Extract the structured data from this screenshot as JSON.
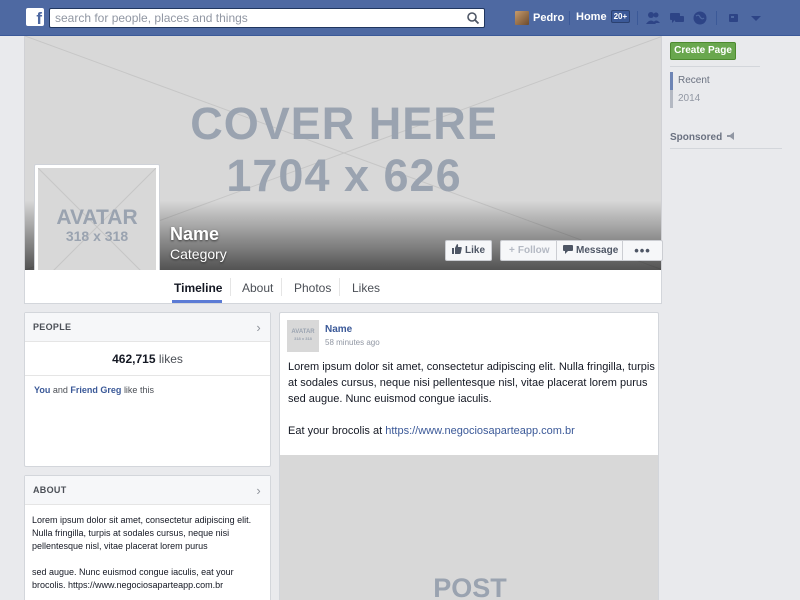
{
  "topbar": {
    "logo": "f",
    "search_placeholder": "search for people, places and things",
    "user_name": "Pedro",
    "home_label": "Home",
    "home_count": "20+"
  },
  "cover": {
    "line1": "COVER HERE",
    "line2": "1704 x 626"
  },
  "avatar": {
    "line1": "AVATAR",
    "line2": "318 x 318"
  },
  "page": {
    "name": "Name",
    "category": "Category"
  },
  "actions": {
    "like": "Like",
    "follow": "Follow",
    "message": "Message",
    "more": "•••"
  },
  "tabs": [
    "Timeline",
    "About",
    "Photos",
    "Likes"
  ],
  "people": {
    "title": "PEOPLE",
    "likes_count": "462,715",
    "likes_word": "likes",
    "friend1": "You",
    "and_word": "and",
    "friend2": "Friend Greg",
    "like_this": "like this"
  },
  "about": {
    "title": "ABOUT",
    "para1": "Lorem ipsum dolor sit amet, consectetur adipiscing elit. Nulla fringilla, turpis at sodales cursus, neque nisi pellentesque nisl, vitae placerat lorem purus",
    "para2": "sed augue. Nunc euismod congue iaculis, eat your brocolis. https://www.negociosaparteapp.com.br"
  },
  "post": {
    "thumb_line1": "AVATAR",
    "thumb_line2": "318 x 318",
    "author": "Name",
    "time": "58 minutes ago",
    "text": "Lorem ipsum dolor sit amet, consectetur adipiscing elit. Nulla fringilla, turpis at sodales cursus, neque nisi pellentesque nisl, vitae placerat lorem purus sed augue. Nunc euismod congue iaculis.",
    "text2": "Eat your brocolis at",
    "link": "https://www.negociosaparteapp.com.br",
    "image_label": "POST"
  },
  "sidebar": {
    "create_page": "Create Page",
    "years": [
      "Recent",
      "2014"
    ],
    "sponsored": "Sponsored"
  },
  "colors": {
    "topbar": "#4e69a2",
    "link": "#3b5998",
    "create_page": "#69a74e",
    "placeholder_gray": "#d8d8d8"
  }
}
